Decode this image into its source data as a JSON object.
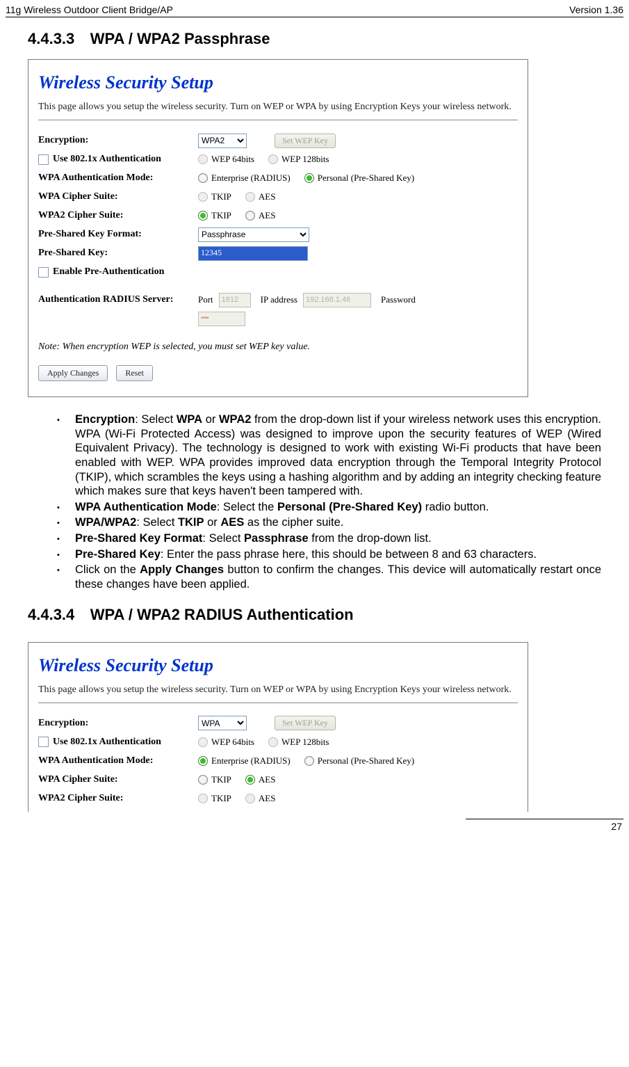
{
  "header": {
    "left": "11g Wireless Outdoor Client Bridge/AP",
    "right": "Version 1.36"
  },
  "footer": {
    "page": "27"
  },
  "sec1": {
    "num": "4.4.3.3",
    "title": "WPA / WPA2 Passphrase"
  },
  "sec2": {
    "num": "4.4.3.4",
    "title": "WPA / WPA2 RADIUS Authentication"
  },
  "shot": {
    "title": "Wireless Security Setup",
    "desc": "This page allows you setup the wireless security. Turn on WEP or WPA by using Encryption Keys your wireless network.",
    "enc_lbl": "Encryption:",
    "enc_val1": "WPA2",
    "enc_val2": "WPA",
    "setwep": "Set WEP Key",
    "use8021x": "Use 802.1x Authentication",
    "wep64": "WEP 64bits",
    "wep128": "WEP 128bits",
    "wpaauth_lbl": "WPA Authentication Mode:",
    "ent": "Enterprise (RADIUS)",
    "psk": "Personal (Pre-Shared Key)",
    "wpacs_lbl": "WPA Cipher Suite:",
    "wpa2cs_lbl": "WPA2 Cipher Suite:",
    "tkip": "TKIP",
    "aes": "AES",
    "pskfmt_lbl": "Pre-Shared Key Format:",
    "pskfmt_val": "Passphrase",
    "pskkey_lbl": "Pre-Shared Key:",
    "pskkey_val": "12345",
    "preauth": "Enable Pre-Authentication",
    "radius_lbl": "Authentication RADIUS Server:",
    "port_lbl": "Port",
    "port_val": "1812",
    "ip_lbl": "IP address",
    "ip_val": "192.168.1.46",
    "pwd_lbl": "Password",
    "pwd_val": "",
    "pwd_dots": "*****",
    "note": "Note: When encryption WEP is selected, you must set WEP key value.",
    "apply": "Apply Changes",
    "reset": "Reset"
  },
  "bul": {
    "b1a": "Encryption",
    "b1b": ": Select ",
    "b1c": "WPA",
    "b1d": " or ",
    "b1e": "WPA2",
    "b1f": " from the drop-down list if your wireless network uses this encryption. WPA (Wi-Fi Protected Access) was designed to improve upon the security features of WEP (Wired Equivalent Privacy). The technology is designed to work with existing Wi-Fi products that have been enabled with WEP. WPA provides improved data encryption through the Temporal Integrity Protocol (TKIP), which scrambles the keys using a hashing algorithm and by adding an integrity checking feature which makes sure that keys haven't been tampered with.",
    "b2a": "WPA Authentication Mode",
    "b2b": ": Select the ",
    "b2c": "Personal (Pre-Shared Key)",
    "b2d": " radio button.",
    "b3a": "WPA/WPA2",
    "b3b": ": Select ",
    "b3c": "TKIP",
    "b3d": " or ",
    "b3e": "AES",
    "b3f": " as the cipher suite.",
    "b4a": "Pre-Shared Key Format",
    "b4b": ": Select ",
    "b4c": "Passphrase",
    "b4d": " from the drop-down list.",
    "b5a": "Pre-Shared Key",
    "b5b": ": Enter the pass phrase here, this should be between 8 and 63 characters.",
    "b6a": "Click on the ",
    "b6b": "Apply Changes",
    "b6c": " button to confirm the changes. This device will automatically restart once these changes have been applied."
  }
}
